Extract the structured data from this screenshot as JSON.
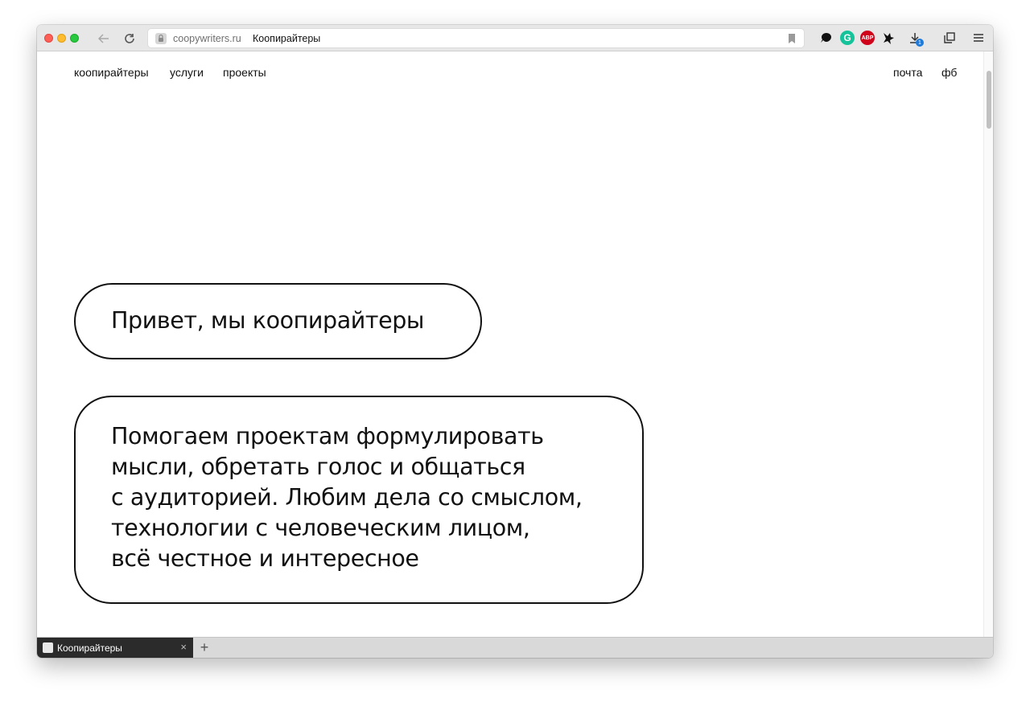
{
  "browser": {
    "url_domain": "coopywriters.ru",
    "url_title": "Коопирайтеры",
    "tab_title": "Коопирайтеры",
    "tab_close": "×",
    "new_tab": "+",
    "extensions": {
      "grammarly": "G",
      "adblock": "ABP",
      "downloads_badge": "1"
    }
  },
  "site": {
    "nav": {
      "left": [
        "коопирайтеры",
        "услуги",
        "проекты"
      ],
      "right": [
        "почта",
        "фб"
      ]
    },
    "hero": {
      "greeting": "Привет, мы коопирайтеры",
      "description_lines": [
        "Помогаем проектам формулировать",
        "мысли, обретать голос и общаться",
        "с аудиторией. Любим дела со смыслом,",
        "технологии с человеческим лицом,",
        "всё честное и интересное"
      ]
    }
  }
}
